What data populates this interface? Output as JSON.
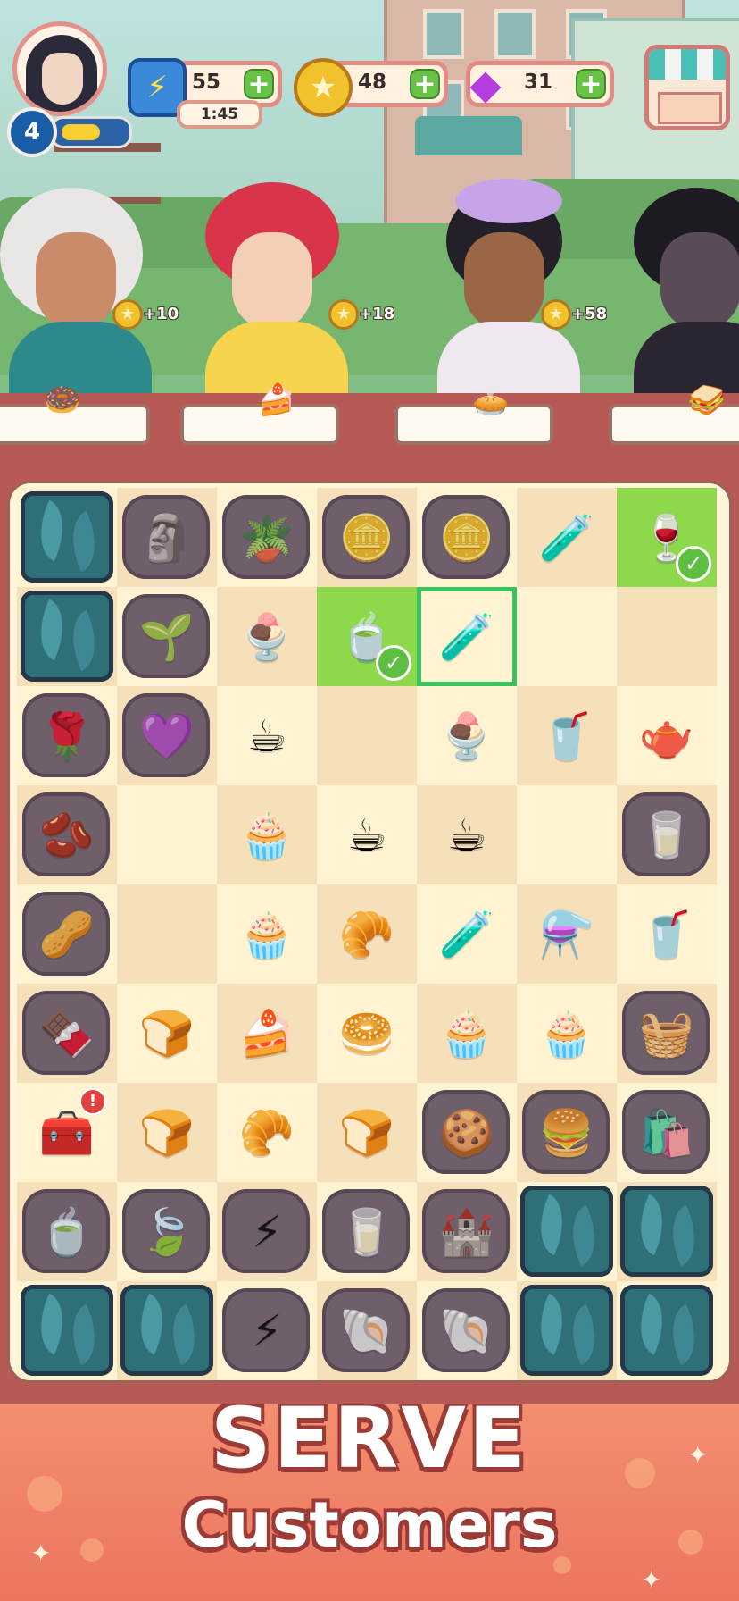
{
  "hud": {
    "player_level": "4",
    "level_progress": 0.65,
    "energy": {
      "value": "55",
      "timer": "1:45",
      "icon": "lightning-icon"
    },
    "coins": {
      "value": "48",
      "icon": "coin-icon"
    },
    "gems": {
      "value": "31",
      "icon": "gem-icon"
    },
    "plus_label": "+",
    "shop_icon": "shop-stall-icon"
  },
  "customers": [
    {
      "reward": "+10",
      "order_icon": "donut-icon",
      "order_glyph": "🍩",
      "skin": "#c98b6a",
      "hair": "#e9e6e6",
      "shirt": "#2d8a8a"
    },
    {
      "reward": "+18",
      "order_icon": "cake-slice-icon",
      "order_glyph": "🍰",
      "skin": "#f3cfb6",
      "hair": "#d8344a",
      "shirt": "#f7d44d"
    },
    {
      "reward": "+58",
      "order_icon": "pie-icon",
      "order_glyph": "🥧",
      "skin": "#9a6646",
      "hair": "#24202a",
      "shirt": "#efe8f0"
    },
    {
      "reward": "",
      "order_icon": "sandwich-icon",
      "order_glyph": "🥪",
      "skin": "#5a4b58",
      "hair": "#1e1a22",
      "shirt": "#2a2530"
    }
  ],
  "board": {
    "rows": [
      [
        {
          "t": "leaf"
        },
        {
          "t": "locked",
          "icon": "garden-gnome-icon",
          "g": "🗿"
        },
        {
          "t": "locked",
          "icon": "flower-barrel-icon",
          "g": "🪴"
        },
        {
          "t": "locked",
          "icon": "coins-icon",
          "g": "🪙"
        },
        {
          "t": "locked",
          "icon": "coin-stack-icon",
          "g": "🪙"
        },
        {
          "t": "light",
          "icon": "potion-bottle-icon",
          "g": "🧪"
        },
        {
          "t": "ready",
          "icon": "goblet-icon",
          "g": "🍷"
        }
      ],
      [
        {
          "t": "leaf"
        },
        {
          "t": "locked",
          "icon": "potted-plant-icon",
          "g": "🌱"
        },
        {
          "t": "dark",
          "icon": "sundae-icon",
          "g": "🍨"
        },
        {
          "t": "ready",
          "icon": "tea-cup-icon",
          "g": "🍵"
        },
        {
          "t": "selected",
          "icon": "test-tubes-icon",
          "g": "🧪"
        },
        {
          "t": "dark",
          "icon": "",
          "g": ""
        },
        {
          "t": "light",
          "icon": "",
          "g": ""
        }
      ],
      [
        {
          "t": "locked",
          "icon": "rose-bush-icon",
          "g": "🌹"
        },
        {
          "t": "locked",
          "icon": "lavender-icon",
          "g": "💜"
        },
        {
          "t": "dark",
          "icon": "cups-icon",
          "g": "☕"
        },
        {
          "t": "light",
          "icon": "",
          "g": ""
        },
        {
          "t": "dark",
          "icon": "sundae-icon",
          "g": "🍨"
        },
        {
          "t": "light",
          "icon": "coffee-cup-icon",
          "g": "🥤"
        },
        {
          "t": "dark",
          "icon": "tea-set-icon",
          "g": "🫖"
        }
      ],
      [
        {
          "t": "locked",
          "icon": "coffee-grounds-icon",
          "g": "🫘"
        },
        {
          "t": "dark",
          "icon": "",
          "g": ""
        },
        {
          "t": "light",
          "icon": "cupcake-icon",
          "g": "🧁"
        },
        {
          "t": "dark",
          "icon": "cups-icon",
          "g": "☕"
        },
        {
          "t": "light",
          "icon": "latte-icon",
          "g": "☕"
        },
        {
          "t": "dark",
          "icon": "",
          "g": ""
        },
        {
          "t": "locked",
          "icon": "milk-jug-icon",
          "g": "🥛"
        }
      ],
      [
        {
          "t": "locked",
          "icon": "almonds-icon",
          "g": "🥜"
        },
        {
          "t": "light",
          "icon": "",
          "g": ""
        },
        {
          "t": "dark",
          "icon": "cupcake-icon",
          "g": "🧁"
        },
        {
          "t": "light",
          "icon": "croissant-icon",
          "g": "🥐"
        },
        {
          "t": "dark",
          "icon": "potion-bottle-icon",
          "g": "🧪"
        },
        {
          "t": "light",
          "icon": "potion-pair-icon",
          "g": "⚗️"
        },
        {
          "t": "dark",
          "icon": "coffee-cup-icon",
          "g": "🥤"
        }
      ],
      [
        {
          "t": "locked",
          "icon": "lava-cake-icon",
          "g": "🍫"
        },
        {
          "t": "dark",
          "icon": "bun-icon",
          "g": "🍞"
        },
        {
          "t": "light",
          "icon": "layer-cake-icon",
          "g": "🍰"
        },
        {
          "t": "dark",
          "icon": "cinnamon-bun-icon",
          "g": "🥯"
        },
        {
          "t": "light",
          "icon": "cupcake-icon",
          "g": "🧁"
        },
        {
          "t": "dark",
          "icon": "cupcake-icon",
          "g": "🧁"
        },
        {
          "t": "locked",
          "icon": "basket-icon",
          "g": "🧺"
        }
      ],
      [
        {
          "t": "light",
          "icon": "treasure-chest-icon",
          "g": "🧰",
          "alert": "!"
        },
        {
          "t": "light",
          "icon": "bun-icon",
          "g": "🍞"
        },
        {
          "t": "dark",
          "icon": "croissant-icon",
          "g": "🥐"
        },
        {
          "t": "light",
          "icon": "bun-icon",
          "g": "🍞"
        },
        {
          "t": "locked",
          "icon": "cookies-icon",
          "g": "🍪"
        },
        {
          "t": "locked",
          "icon": "macaron-stack-icon",
          "g": "🍔"
        },
        {
          "t": "locked",
          "icon": "paper-bag-icon",
          "g": "🛍️"
        }
      ],
      [
        {
          "t": "locked",
          "icon": "tea-bowl-icon",
          "g": "🍵"
        },
        {
          "t": "locked",
          "icon": "leaves-icon",
          "g": "🍃"
        },
        {
          "t": "locked",
          "icon": "energy-token-icon",
          "g": "⚡"
        },
        {
          "t": "locked",
          "icon": "milk-carton-icon",
          "g": "🥛"
        },
        {
          "t": "locked",
          "icon": "sandcastle-icon",
          "g": "🏰"
        },
        {
          "t": "leaf"
        },
        {
          "t": "leaf"
        }
      ],
      [
        {
          "t": "leaf"
        },
        {
          "t": "leaf"
        },
        {
          "t": "locked",
          "icon": "energy-tokens-icon",
          "g": "⚡"
        },
        {
          "t": "locked",
          "icon": "seashell-icon",
          "g": "🐚"
        },
        {
          "t": "locked",
          "icon": "shells-starfish-icon",
          "g": "🐚"
        },
        {
          "t": "leaf"
        },
        {
          "t": "leaf"
        }
      ]
    ]
  },
  "banner": {
    "line1": "SERVE",
    "line2": "Customers"
  },
  "colors": {
    "accent": "#e28b85",
    "ready": "#8ed84c",
    "selected_border": "#38c35f",
    "banner": "#ec7560"
  }
}
